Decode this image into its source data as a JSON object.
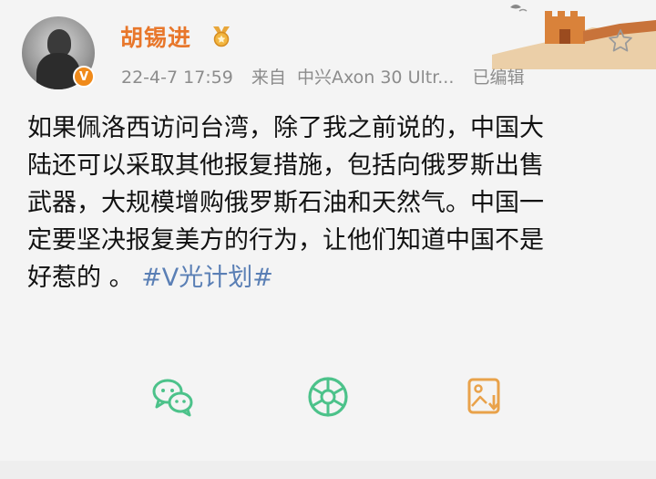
{
  "post": {
    "username": "胡锡进",
    "avatar_badge": "V",
    "timestamp": "22-4-7 17:59",
    "source_prefix": "来自",
    "source_device": "中兴Axon 30 Ultr...",
    "edited_label": "已编辑",
    "content_lines": [
      "如果佩洛西访问台湾，除了我之前说的，中国大",
      "陆还可以采取其他报复措施，包括向俄罗斯出售",
      "武器，大规模增购俄罗斯石油和天然气。中国一",
      "定要坚决报复美方的行为，让他们知道中国不是"
    ],
    "last_line_text": "好惹的 。",
    "hashtag": "#V光计划#"
  },
  "icons": {
    "medal": "medal-icon",
    "star": "star-icon",
    "wechat": "wechat-icon",
    "moments": "moments-icon",
    "save_image": "save-image-icon"
  },
  "colors": {
    "username": "#e8772b",
    "meta": "#8c8c8c",
    "hashtag": "#5a7fb5",
    "vbadge": "#f08a1a",
    "share_green": "#4cc28a",
    "save_orange": "#e9a24a"
  }
}
